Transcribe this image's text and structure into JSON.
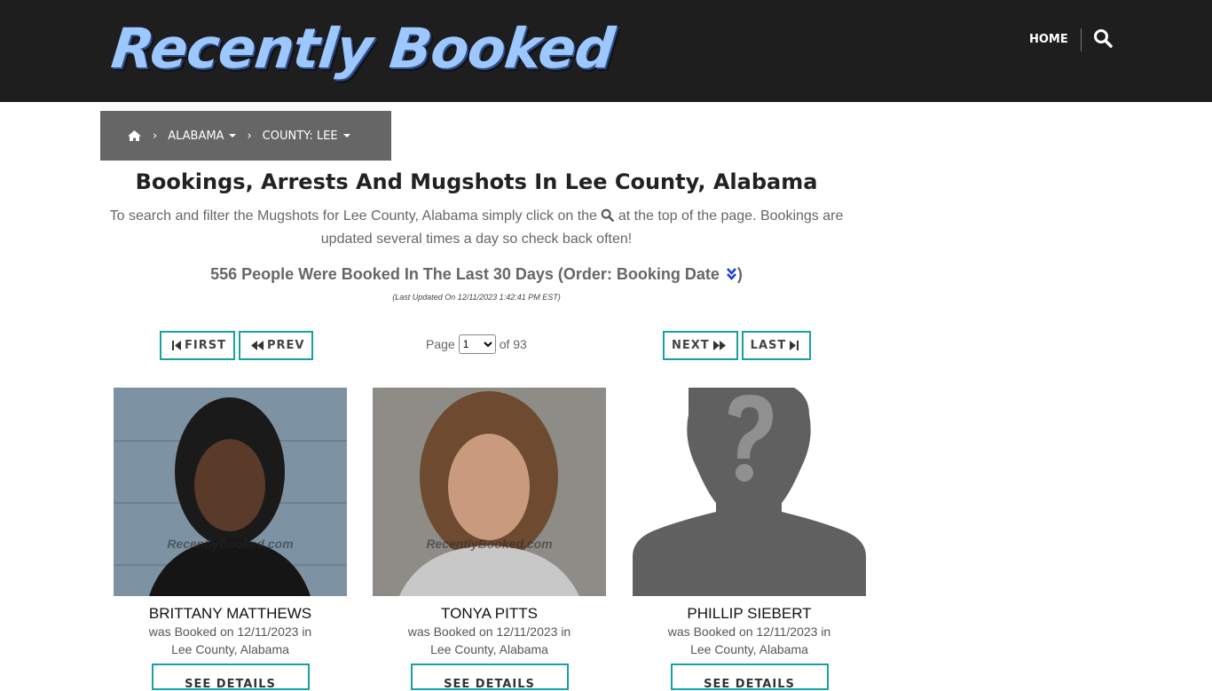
{
  "header": {
    "logo_text": "Recently Booked",
    "nav_home": "HOME",
    "search_icon": "search-icon"
  },
  "breadcrumb": {
    "home_icon": "home-icon",
    "state": "ALABAMA",
    "county": "COUNTY: LEE"
  },
  "main": {
    "title": "Bookings, Arrests And Mugshots In Lee County, Alabama",
    "intro_before": "To search and filter the Mugshots for Lee County, Alabama simply click on the",
    "intro_after": "at the top of the page. Bookings are updated several times a day so check back often!",
    "count_text": "556 People Were Booked In The Last 30 Days (Order: Booking Date",
    "count_close": ")",
    "updated": "(Last Updated On 12/11/2023 1:42:41 PM EST)"
  },
  "pager": {
    "first": "FIRST",
    "prev": "PREV",
    "next": "NEXT",
    "last": "LAST",
    "page_label": "Page",
    "page_value": "1",
    "of_label": "of 93"
  },
  "watermark": "RecentlyBooked.com",
  "cards": [
    {
      "name": "BRITTANY MATTHEWS",
      "line1": "was Booked on 12/11/2023 in",
      "line2": "Lee County, Alabama",
      "button": "SEE DETAILS"
    },
    {
      "name": "TONYA PITTS",
      "line1": "was Booked on 12/11/2023 in",
      "line2": "Lee County, Alabama",
      "button": "SEE DETAILS"
    },
    {
      "name": "PHILLIP SIEBERT",
      "line1": "was Booked on 12/11/2023 in",
      "line2": "Lee County, Alabama",
      "button": "SEE DETAILS"
    }
  ],
  "colors": {
    "accent": "#17a2a0",
    "header_bg": "#1e1e1e",
    "breadcrumb_bg": "#666666"
  }
}
